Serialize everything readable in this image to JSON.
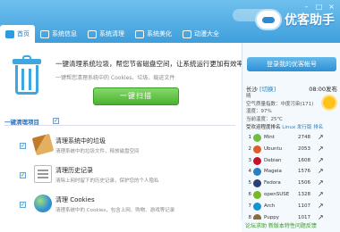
{
  "window": {
    "controls": [
      "–",
      "□",
      "×"
    ]
  },
  "brand": {
    "logo_text": "优客助手"
  },
  "nav": [
    {
      "label": "首页",
      "icon": "home-icon",
      "active": true
    },
    {
      "label": "系统信息",
      "icon": "monitor-icon",
      "active": false
    },
    {
      "label": "系统清理",
      "icon": "broom-icon",
      "active": false
    },
    {
      "label": "系统美化",
      "icon": "heart-icon",
      "active": false
    },
    {
      "label": "动漫大全",
      "icon": "anime-icon",
      "active": false
    }
  ],
  "main": {
    "hero_title": "一键清理系统垃圾，帮您节省磁盘空间，让系统运行更加有效率！",
    "hero_desc": "一键帮您清理系统中的 Cookies、垃圾、痕迹文件",
    "scan_button": "一键扫描",
    "section_title": "一键清理项目",
    "items": [
      {
        "title": "清理系统中的垃圾",
        "desc": "清理系统中的垃圾文件，释放磁盘空间",
        "icon": "broom-icon"
      },
      {
        "title": "清理历史记录",
        "desc": "清除上网时留下的历史记录，保护您的个人隐私",
        "icon": "history-icon"
      },
      {
        "title": "清理 Cookies",
        "desc": "清理系统中的 Cookies，包含上网、购物、游戏等记录",
        "icon": "globe-icon"
      }
    ]
  },
  "side": {
    "banner": "登录我的优客帐号",
    "city": "长沙",
    "switch_label": "[切换]",
    "time": "08:00发布",
    "weather_line1": "晴",
    "weather_line2": "空气质量指数：中度污染(171)",
    "weather_line3": "湿度：97%",
    "temp": "当前温度：25℃",
    "rank_title_prefix": "受欢迎程度排名",
    "rank_title_suffix": "Linux 发行版 排名",
    "rank": [
      {
        "num": "1",
        "name": "Mint",
        "score": "2748",
        "color": "#6dbe45"
      },
      {
        "num": "2",
        "name": "Ubuntu",
        "score": "2053",
        "color": "#e05a2a"
      },
      {
        "num": "3",
        "name": "Debian",
        "score": "1608",
        "color": "#c8102e"
      },
      {
        "num": "4",
        "name": "Mageia",
        "score": "1576",
        "color": "#2a7fc1"
      },
      {
        "num": "5",
        "name": "Fedora",
        "score": "1506",
        "color": "#294172"
      },
      {
        "num": "6",
        "name": "openSUSE",
        "score": "1328",
        "color": "#73ba25"
      },
      {
        "num": "7",
        "name": "Arch",
        "score": "1107",
        "color": "#1793d1"
      },
      {
        "num": "8",
        "name": "Puppy",
        "score": "1017",
        "color": "#8a6b3a"
      }
    ],
    "rank_arrow": "↗",
    "footer_links": "论坛求助 新版本特性问题反馈"
  }
}
